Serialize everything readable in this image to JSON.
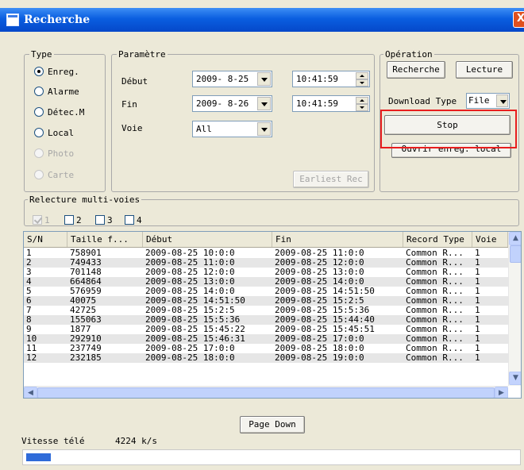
{
  "window": {
    "title": "Recherche",
    "close_glyph": "X"
  },
  "type_group": {
    "legend": "Type",
    "options": [
      {
        "label": "Enreg.",
        "selected": true,
        "enabled": true
      },
      {
        "label": "Alarme",
        "selected": false,
        "enabled": true
      },
      {
        "label": "Détec.M",
        "selected": false,
        "enabled": true
      },
      {
        "label": "Local",
        "selected": false,
        "enabled": true
      },
      {
        "label": "Photo",
        "selected": false,
        "enabled": false
      },
      {
        "label": "Carte",
        "selected": false,
        "enabled": false
      }
    ]
  },
  "param_group": {
    "legend": "Paramètre",
    "debut_label": "Début",
    "fin_label": "Fin",
    "voie_label": "Voie",
    "debut_date": "2009- 8-25",
    "debut_time": "10:41:59",
    "fin_date": "2009- 8-26",
    "fin_time": "10:41:59",
    "voie_value": "All",
    "earliest_button": "Earliest Rec"
  },
  "operation_group": {
    "legend": "Opération",
    "search_button": "Recherche",
    "play_button": "Lecture",
    "download_type_label": "Download Type",
    "download_type_value": "File",
    "stop_button": "Stop",
    "open_local_button": "Ouvrir enreg. local"
  },
  "multi_group": {
    "legend": "Relecture multi-voies",
    "channels": [
      {
        "label": "1",
        "checked": true,
        "enabled": false
      },
      {
        "label": "2",
        "checked": false,
        "enabled": true
      },
      {
        "label": "3",
        "checked": false,
        "enabled": true
      },
      {
        "label": "4",
        "checked": false,
        "enabled": true
      }
    ]
  },
  "table": {
    "columns": [
      "S/N",
      "Taille f...",
      "Début",
      "Fin",
      "Record Type",
      "Voie"
    ],
    "rows": [
      [
        "1",
        "758901",
        "2009-08-25 10:0:0",
        "2009-08-25 11:0:0",
        "Common R...",
        "1"
      ],
      [
        "2",
        "749433",
        "2009-08-25 11:0:0",
        "2009-08-25 12:0:0",
        "Common R...",
        "1"
      ],
      [
        "3",
        "701148",
        "2009-08-25 12:0:0",
        "2009-08-25 13:0:0",
        "Common R...",
        "1"
      ],
      [
        "4",
        "664864",
        "2009-08-25 13:0:0",
        "2009-08-25 14:0:0",
        "Common R...",
        "1"
      ],
      [
        "5",
        "576959",
        "2009-08-25 14:0:0",
        "2009-08-25 14:51:50",
        "Common R...",
        "1"
      ],
      [
        "6",
        "40075",
        "2009-08-25 14:51:50",
        "2009-08-25 15:2:5",
        "Common R...",
        "1"
      ],
      [
        "7",
        "42725",
        "2009-08-25 15:2:5",
        "2009-08-25 15:5:36",
        "Common R...",
        "1"
      ],
      [
        "8",
        "155063",
        "2009-08-25 15:5:36",
        "2009-08-25 15:44:40",
        "Common R...",
        "1"
      ],
      [
        "9",
        "1877",
        "2009-08-25 15:45:22",
        "2009-08-25 15:45:51",
        "Common R...",
        "1"
      ],
      [
        "10",
        "292910",
        "2009-08-25 15:46:31",
        "2009-08-25 17:0:0",
        "Common R...",
        "1"
      ],
      [
        "11",
        "237749",
        "2009-08-25 17:0:0",
        "2009-08-25 18:0:0",
        "Common R...",
        "1"
      ],
      [
        "12",
        "232185",
        "2009-08-25 18:0:0",
        "2009-08-25 19:0:0",
        "Common R...",
        "1"
      ]
    ],
    "row_bg_even": "#ffffff",
    "row_bg_odd": "#e6e6e6"
  },
  "page_down_button": "Page Down",
  "speed": {
    "label": "Vitesse télé",
    "value": "4224 k/s"
  },
  "progress": {
    "fraction": 0.05
  },
  "colors": {
    "highlight_box": "#e81e1e",
    "title_bar": "#0a5ee0",
    "progress": "#2f6bd9"
  }
}
